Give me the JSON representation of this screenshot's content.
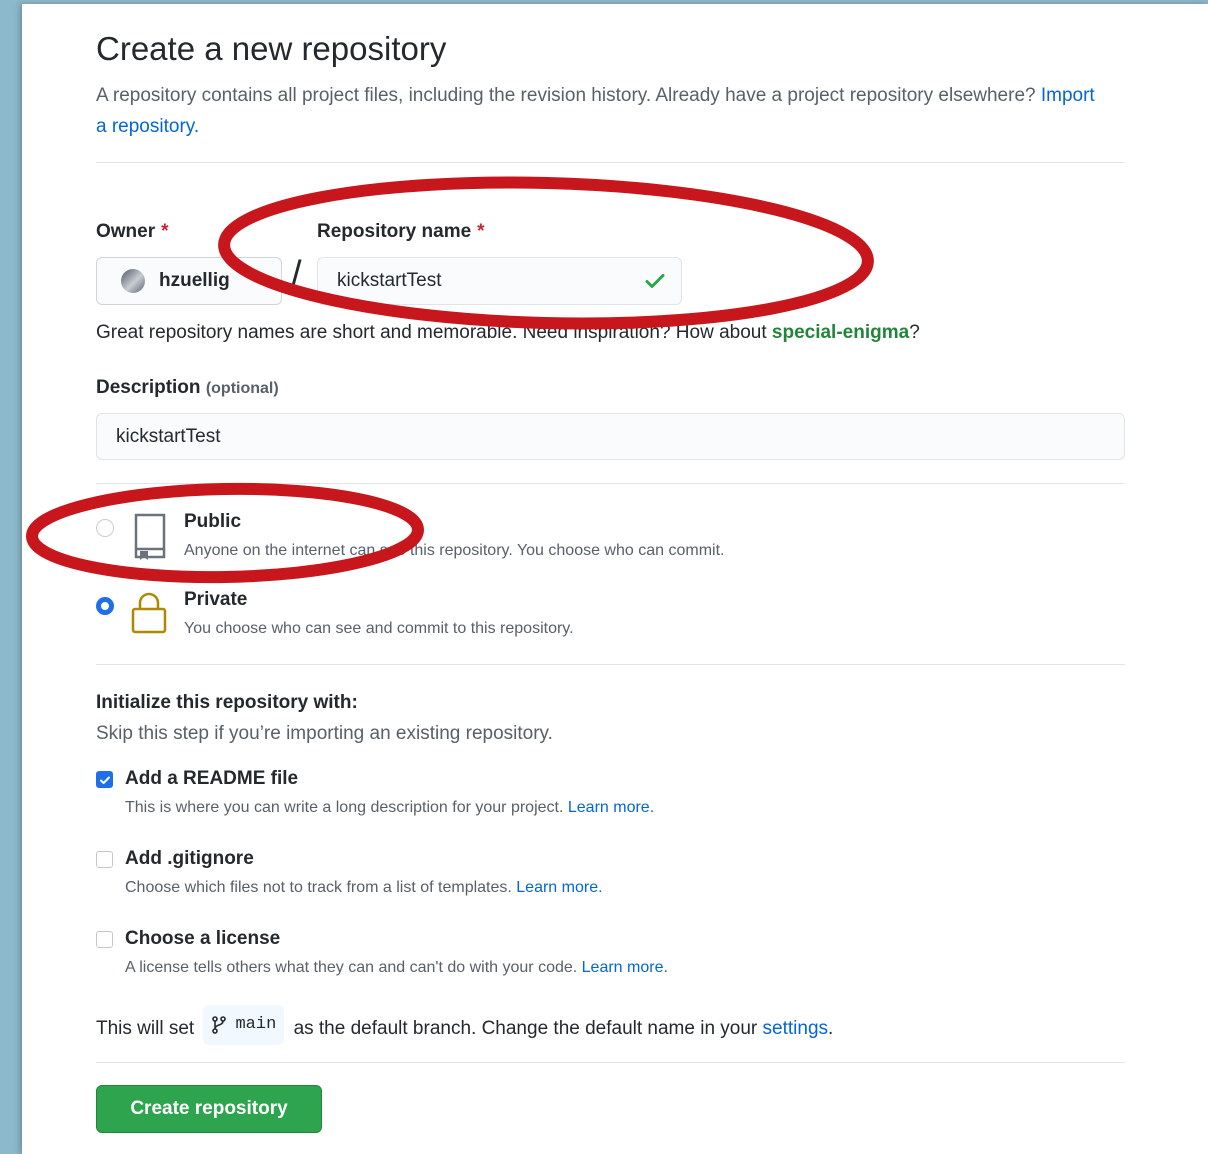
{
  "page": {
    "title": "Create a new repository",
    "lead_text": "A repository contains all project files, including the revision history. Already have a project repository elsewhere?",
    "import_link": "Import a repository."
  },
  "owner": {
    "label": "Owner",
    "required_mark": "*",
    "value": "hzuellig"
  },
  "separator": "/",
  "repo_name": {
    "label": "Repository name",
    "required_mark": "*",
    "value": "kickstartTest",
    "valid_icon": "check-icon"
  },
  "name_hint": {
    "prefix": "Great repository names are short and memorable. Need inspiration? How about",
    "suggestion": "special-enigma",
    "suffix": "?"
  },
  "description": {
    "label": "Description",
    "optional": "(optional)",
    "value": "kickstartTest"
  },
  "visibility": {
    "options": [
      {
        "title": "Public",
        "desc": "Anyone on the internet can see this repository. You choose who can commit.",
        "icon": "repo-icon",
        "selected": false
      },
      {
        "title": "Private",
        "desc": "You choose who can see and commit to this repository.",
        "icon": "lock-icon",
        "selected": true
      }
    ]
  },
  "init": {
    "heading": "Initialize this repository with:",
    "subheading": "Skip this step if you’re importing an existing repository.",
    "items": [
      {
        "title": "Add a README file",
        "desc": "This is where you can write a long description for your project.",
        "link": "Learn more.",
        "checked": true
      },
      {
        "title": "Add .gitignore",
        "desc": "Choose which files not to track from a list of templates.",
        "link": "Learn more.",
        "checked": false
      },
      {
        "title": "Choose a license",
        "desc": "A license tells others what they can and can't do with your code.",
        "link": "Learn more.",
        "checked": false
      }
    ]
  },
  "branch_note": {
    "prefix": "This will set",
    "branch": "main",
    "middle": "as the default branch. Change the default name in your",
    "link": "settings",
    "suffix": "."
  },
  "submit": {
    "label": "Create repository"
  },
  "colors": {
    "primary_button": "#2ea44f",
    "link": "#0366d6",
    "annotation": "#c8161d",
    "private_lock": "#b08800"
  }
}
